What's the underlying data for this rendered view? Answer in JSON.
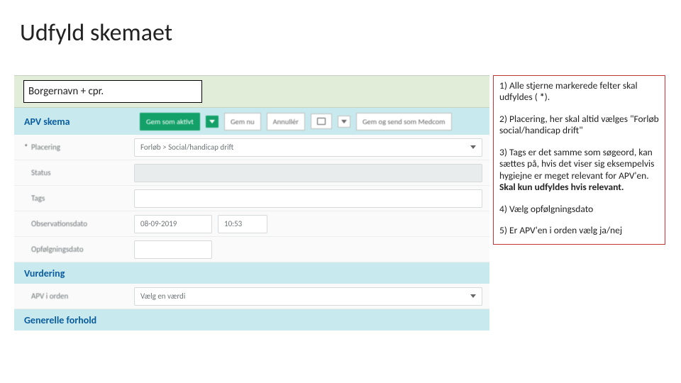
{
  "title": "Udfyld skemaet",
  "borger_label": "Borgernavn + cpr.",
  "toolbar": {
    "section": "APV skema",
    "primary": "Gem som aktivt",
    "save": "Gem nu",
    "cancel": "Annullér",
    "medcom": "Gem og send som Medcom"
  },
  "form": {
    "placering_label": "Placering",
    "placering_value": "Forløb > Social/handicap drift",
    "status_label": "Status",
    "tags_label": "Tags",
    "obs_label": "Observationsdato",
    "obs_date": "08-09-2019",
    "obs_time": "10:53",
    "opf_label": "Opfølgningsdato",
    "vurdering_section": "Vurdering",
    "apviorden_label": "APV i orden",
    "apviorden_value": "Vælg en værdi",
    "generelle_section": "Generelle forhold"
  },
  "instructions": {
    "i1a": "1) Alle stjerne markerede felter skal udfyldes ( ",
    "i1b": "*",
    "i1c": ").",
    "i2": "2) Placering, her skal altid vælges \"Forløb social/handicap drift\"",
    "i3a": "3) Tags er det samme som søgeord, kan sættes på, hvis det viser sig eksempelvis hygiejne er meget relevant for APV'en. ",
    "i3b": "Skal kun udfyldes hvis relevant.",
    "i4": "4) Vælg opfølgningsdato",
    "i5": "5) Er APV'en i orden vælg ja/nej"
  }
}
